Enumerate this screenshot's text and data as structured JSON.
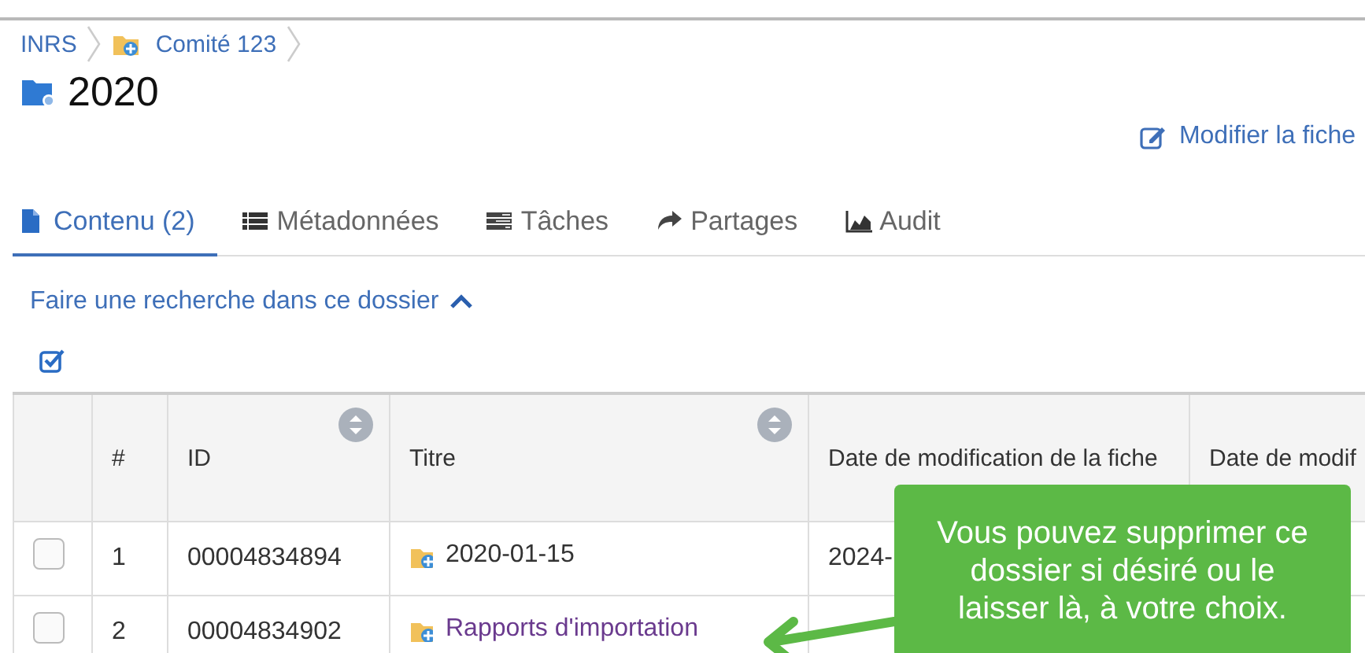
{
  "breadcrumb": [
    {
      "label": "INRS",
      "folder": false
    },
    {
      "label": "Comité 123",
      "folder": true
    }
  ],
  "folder": {
    "title": "2020"
  },
  "edit_link": {
    "label": "Modifier la fiche"
  },
  "tabs": [
    {
      "label": "Contenu (2)",
      "selected": true
    },
    {
      "label": "Métadonnées",
      "selected": false
    },
    {
      "label": "Tâches",
      "selected": false
    },
    {
      "label": "Partages",
      "selected": false
    },
    {
      "label": "Audit",
      "selected": false
    }
  ],
  "search_toggle": {
    "label": "Faire une recherche dans ce dossier",
    "expanded": true
  },
  "table": {
    "columns": [
      {
        "label": "#",
        "sortable": false
      },
      {
        "label": "ID",
        "sortable": true
      },
      {
        "label": "Titre",
        "sortable": true
      },
      {
        "label": "Date de modification de la fiche",
        "sortable": false
      },
      {
        "label": "Date de modif"
      }
    ],
    "rows": [
      {
        "checked": false,
        "number": "1",
        "id": "00004834894",
        "title": "2020-01-15",
        "visited": false,
        "date": "2024-"
      },
      {
        "checked": false,
        "number": "2",
        "id": "00004834902",
        "title": "Rapports d'importation",
        "visited": true
      }
    ]
  },
  "callout": {
    "text": "Vous pouvez supprimer ce dossier si désiré ou le laisser là, à votre choix."
  }
}
